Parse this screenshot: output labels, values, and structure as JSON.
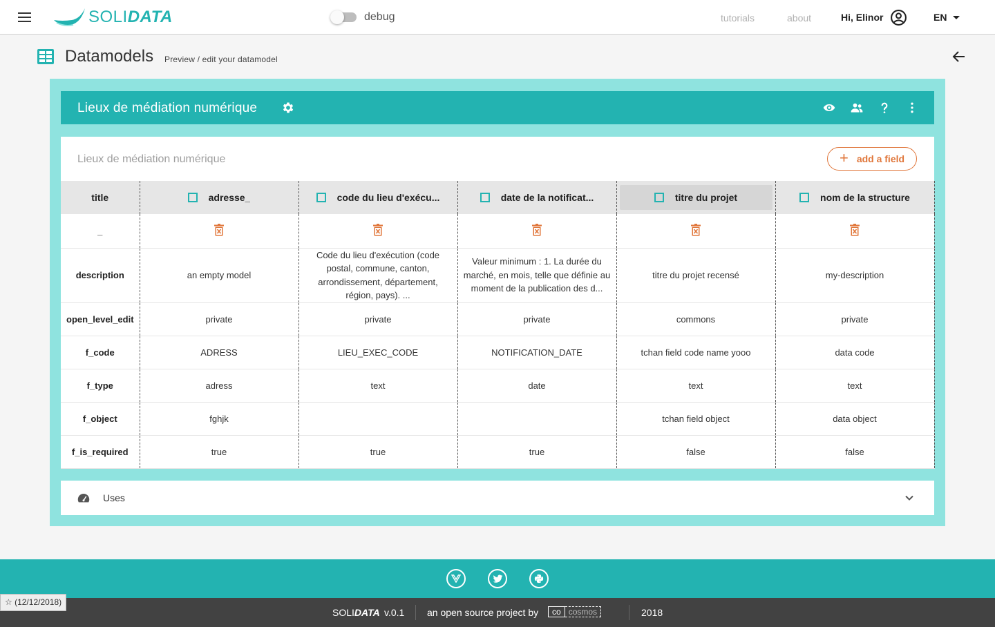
{
  "app": {
    "logo_prefix": "SOLI",
    "logo_suffix": "DATA",
    "debug_label": "debug",
    "nav": {
      "tutorials": "tutorials",
      "about": "about"
    },
    "greeting": "Hi, Elinor",
    "language": "EN"
  },
  "page": {
    "title": "Datamodels",
    "subtitle": "Preview / edit your datamodel"
  },
  "datamodel": {
    "name": "Lieux de médiation numérique",
    "card_title": "Lieux de médiation numérique",
    "add_field_label": "add a field",
    "header_row_label": "title",
    "rows": [
      {
        "key": "delete",
        "label": "_"
      },
      {
        "key": "description",
        "label": "description"
      },
      {
        "key": "open_level_edit",
        "label": "open_level_edit"
      },
      {
        "key": "f_code",
        "label": "f_code"
      },
      {
        "key": "f_type",
        "label": "f_type"
      },
      {
        "key": "f_object",
        "label": "f_object"
      },
      {
        "key": "f_is_required",
        "label": "f_is_required"
      }
    ],
    "fields": [
      {
        "title": "adresse_",
        "description": "an empty model",
        "open_level_edit": "private",
        "f_code": "ADRESS",
        "f_type": "adress",
        "f_object": "fghjk",
        "f_is_required": "true"
      },
      {
        "title": "code du lieu d'exécu...",
        "description": "Code du lieu d'exécution (code postal, commune, canton, arrondissement, département, région, pays). ...",
        "open_level_edit": "private",
        "f_code": "LIEU_EXEC_CODE",
        "f_type": "text",
        "f_object": "",
        "f_is_required": "true"
      },
      {
        "title": "date de la notificat...",
        "description": "Valeur minimum : 1. La durée du marché, en mois, telle que définie au moment de la publication des d...",
        "open_level_edit": "private",
        "f_code": "NOTIFICATION_DATE",
        "f_type": "date",
        "f_object": "",
        "f_is_required": "true"
      },
      {
        "title": "titre du projet",
        "description": "titre du projet recensé",
        "open_level_edit": "commons",
        "f_code": "tchan field code name yooo",
        "f_type": "text",
        "f_object": "tchan field object",
        "f_is_required": "false"
      },
      {
        "title": "nom de la structure",
        "description": "my-description",
        "open_level_edit": "private",
        "f_code": "data code",
        "f_type": "text",
        "f_object": "data object",
        "f_is_required": "false"
      }
    ],
    "uses_label": "Uses"
  },
  "footer": {
    "brand_prefix": "SOLI",
    "brand_suffix": "DATA",
    "version": "v.0.1",
    "tagline": "an open source project by",
    "co_logo_a": "co",
    "co_logo_b": "cosmos",
    "year": "2018",
    "build_badge": "☆ (12/12/2018)"
  },
  "colors": {
    "accent": "#23b3b1",
    "panel_bg": "#8fe3df",
    "action_orange": "#e0763a",
    "footer_dark": "#424242"
  },
  "icons": [
    "menu-icon",
    "datamodel-grid-icon",
    "back-arrow-icon",
    "gear-icon",
    "eye-icon",
    "people-icon",
    "help-icon",
    "more-vert-icon",
    "plus-icon",
    "trash-icon",
    "speedometer-icon",
    "chevron-down-icon",
    "vue-icon",
    "twitter-icon",
    "python-icon",
    "account-circle-icon"
  ]
}
